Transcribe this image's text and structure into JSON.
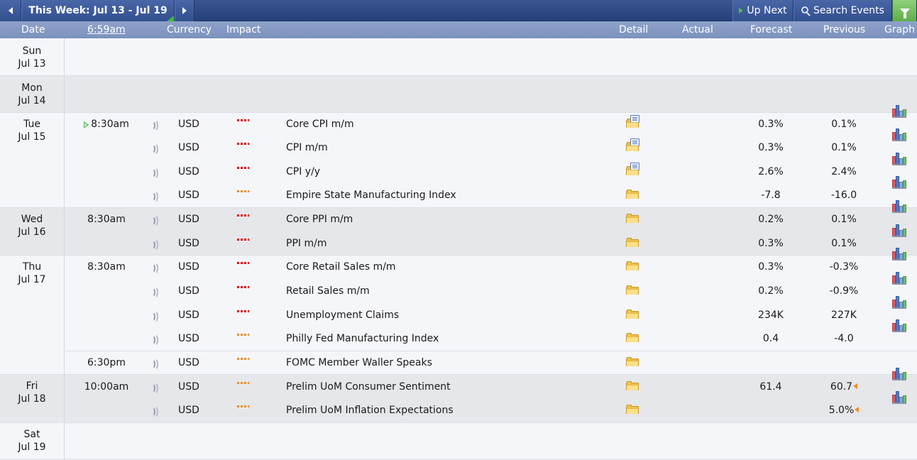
{
  "toolbar": {
    "week_label": "This Week: Jul 13 - Jul 19",
    "up_next_label": "Up Next",
    "search_label": "Search Events"
  },
  "columns": {
    "date": "Date",
    "current_time": "6:59am",
    "currency": "Currency",
    "impact": "Impact",
    "detail": "Detail",
    "actual": "Actual",
    "forecast": "Forecast",
    "previous": "Previous",
    "graph": "Graph"
  },
  "days": [
    {
      "dow": "Sun",
      "date": "Jul 13"
    },
    {
      "dow": "Mon",
      "date": "Jul 14"
    },
    {
      "dow": "Tue",
      "date": "Jul 15"
    },
    {
      "dow": "Wed",
      "date": "Jul 16"
    },
    {
      "dow": "Thu",
      "date": "Jul 17"
    },
    {
      "dow": "Fri",
      "date": "Jul 18"
    },
    {
      "dow": "Sat",
      "date": "Jul 19"
    }
  ],
  "events": [
    {
      "time": "8:30am",
      "currency": "USD",
      "impact": "high",
      "title": "Core CPI m/m",
      "actual": "",
      "forecast": "0.3%",
      "previous": "0.1%"
    },
    {
      "time": "",
      "currency": "USD",
      "impact": "high",
      "title": "CPI m/m",
      "actual": "",
      "forecast": "0.3%",
      "previous": "0.1%"
    },
    {
      "time": "",
      "currency": "USD",
      "impact": "high",
      "title": "CPI y/y",
      "actual": "",
      "forecast": "2.6%",
      "previous": "2.4%"
    },
    {
      "time": "",
      "currency": "USD",
      "impact": "medium",
      "title": "Empire State Manufacturing Index",
      "actual": "",
      "forecast": "-7.8",
      "previous": "-16.0"
    },
    {
      "time": "8:30am",
      "currency": "USD",
      "impact": "high",
      "title": "Core PPI m/m",
      "actual": "",
      "forecast": "0.2%",
      "previous": "0.1%"
    },
    {
      "time": "",
      "currency": "USD",
      "impact": "high",
      "title": "PPI m/m",
      "actual": "",
      "forecast": "0.3%",
      "previous": "0.1%"
    },
    {
      "time": "8:30am",
      "currency": "USD",
      "impact": "high",
      "title": "Core Retail Sales m/m",
      "actual": "",
      "forecast": "0.3%",
      "previous": "-0.3%"
    },
    {
      "time": "",
      "currency": "USD",
      "impact": "high",
      "title": "Retail Sales m/m",
      "actual": "",
      "forecast": "0.2%",
      "previous": "-0.9%"
    },
    {
      "time": "",
      "currency": "USD",
      "impact": "high",
      "title": "Unemployment Claims",
      "actual": "",
      "forecast": "234K",
      "previous": "227K"
    },
    {
      "time": "",
      "currency": "USD",
      "impact": "medium",
      "title": "Philly Fed Manufacturing Index",
      "actual": "",
      "forecast": "0.4",
      "previous": "-4.0"
    },
    {
      "time": "6:30pm",
      "currency": "USD",
      "impact": "medium",
      "title": "FOMC Member Waller Speaks",
      "actual": "",
      "forecast": "",
      "previous": ""
    },
    {
      "time": "10:00am",
      "currency": "USD",
      "impact": "medium",
      "title": "Prelim UoM Consumer Sentiment",
      "actual": "",
      "forecast": "61.4",
      "previous": "60.7"
    },
    {
      "time": "",
      "currency": "USD",
      "impact": "medium",
      "title": "Prelim UoM Inflation Expectations",
      "actual": "",
      "forecast": "",
      "previous": "5.0%"
    }
  ],
  "colors": {
    "toolbar": "#27407a",
    "header": "#7c91bd",
    "high_impact": "#e00000",
    "medium_impact": "#f08c24",
    "accent_green": "#49b649",
    "row_light": "#f5f6fa",
    "row_grey": "#e6e7ea"
  }
}
